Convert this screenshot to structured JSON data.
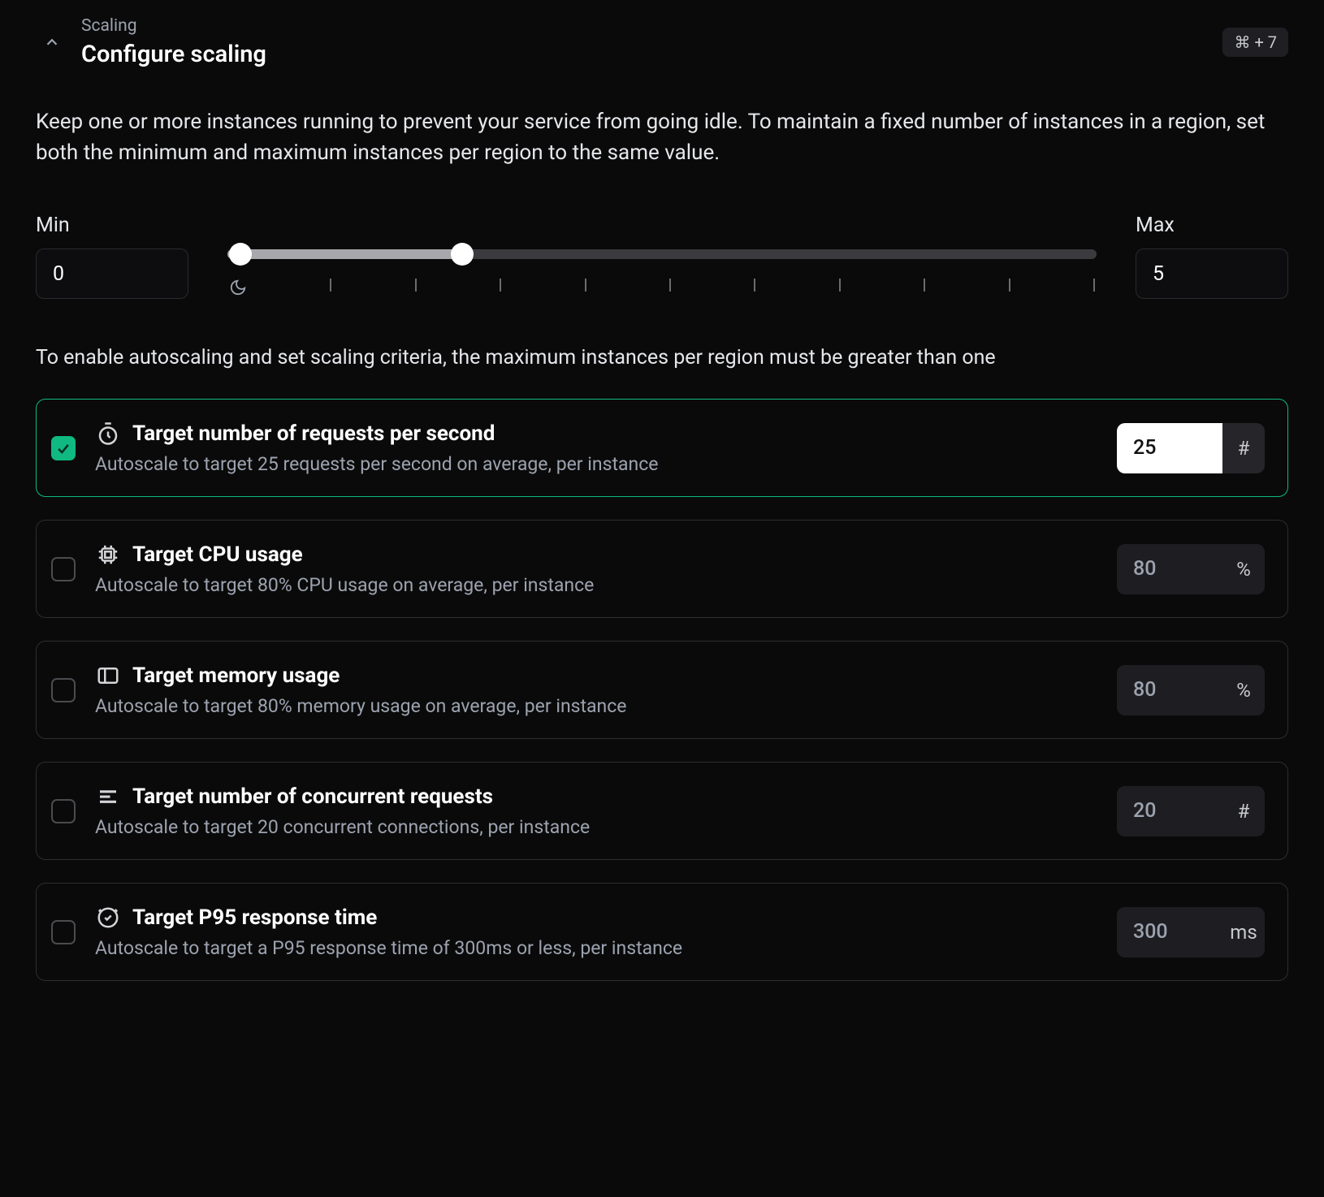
{
  "header": {
    "breadcrumb": "Scaling",
    "title": "Configure scaling",
    "shortcut": "⌘ + 7"
  },
  "description": "Keep one or more instances running to prevent your service from going idle. To maintain a fixed number of instances in a region, set both the minimum and maximum instances per region to the same value.",
  "range": {
    "min_label": "Min",
    "max_label": "Max",
    "min_value": "0",
    "max_value": "5"
  },
  "subdescription": "To enable autoscaling and set scaling criteria, the maximum instances per region must be greater than one",
  "criteria": [
    {
      "title": "Target number of requests per second",
      "desc": "Autoscale to target 25 requests per second on average, per instance",
      "value": "25",
      "unit": "#",
      "checked": true,
      "icon": "stopwatch"
    },
    {
      "title": "Target CPU usage",
      "desc": "Autoscale to target 80% CPU usage on average, per instance",
      "value": "80",
      "unit": "%",
      "checked": false,
      "icon": "cpu"
    },
    {
      "title": "Target memory usage",
      "desc": "Autoscale to target 80% memory usage on average, per instance",
      "value": "80",
      "unit": "%",
      "checked": false,
      "icon": "memory"
    },
    {
      "title": "Target number of concurrent requests",
      "desc": "Autoscale to target 20 concurrent connections, per instance",
      "value": "20",
      "unit": "#",
      "checked": false,
      "icon": "lines"
    },
    {
      "title": "Target P95 response time",
      "desc": "Autoscale to target a P95 response time of 300ms or less, per instance",
      "value": "300",
      "unit": "ms",
      "checked": false,
      "icon": "clock-check"
    }
  ]
}
